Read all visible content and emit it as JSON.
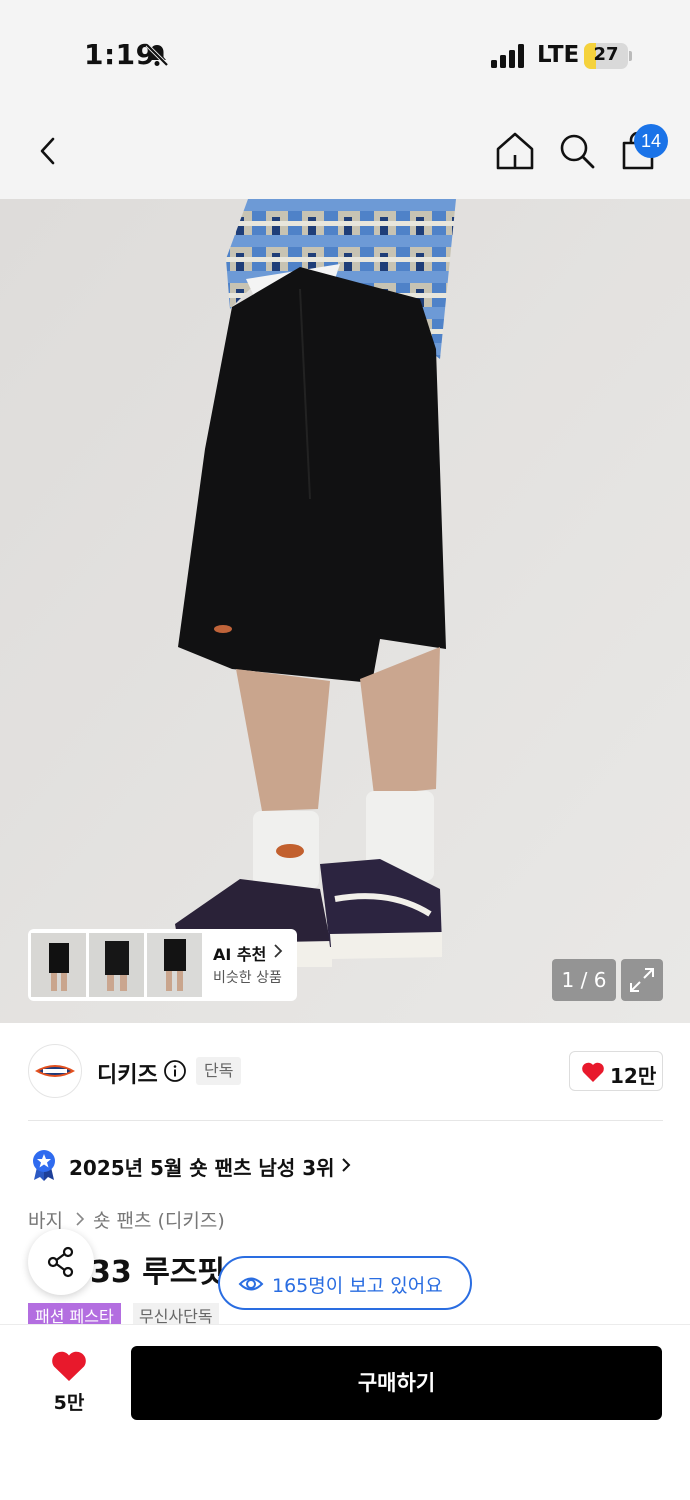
{
  "status_bar": {
    "time": "1:19",
    "network": "LTE",
    "battery": "27",
    "battery_level": 0.27,
    "icons": [
      "bell-muted-icon",
      "signal-icon",
      "battery-icon"
    ]
  },
  "nav": {
    "icons": [
      "back-icon",
      "home-icon",
      "search-icon",
      "cart-icon"
    ],
    "cart_badge": "14",
    "accent": "#1a73e8"
  },
  "gallery": {
    "ai_title": "AI 추천",
    "ai_subtitle": "비슷한 상품",
    "counter": "1 / 6",
    "icons": [
      "chevron-right-icon",
      "expand-icon"
    ]
  },
  "brand": {
    "name": "디키즈",
    "tag": "단독",
    "like_count": "12만",
    "icons": [
      "info-icon",
      "heart-icon"
    ],
    "heart_color": "#e8192c"
  },
  "ranking": {
    "text": "2025년 5월 숏 팬츠 남성 3위",
    "icon": "ranking-badge-icon"
  },
  "category": {
    "level1": "바지",
    "level2": "숏 팬츠 (디키즈)"
  },
  "product": {
    "title_visible": "33 루즈핏 와",
    "viewers": "165명이 보고 있어요",
    "viewers_color": "#2a6de1",
    "tag_festa": "패션 페스타",
    "tag_festa_color": "#b36ee0",
    "tag_exclusive": "무신사단독"
  },
  "bottom_bar": {
    "wish_count": "5만",
    "buy_label": "구매하기"
  }
}
